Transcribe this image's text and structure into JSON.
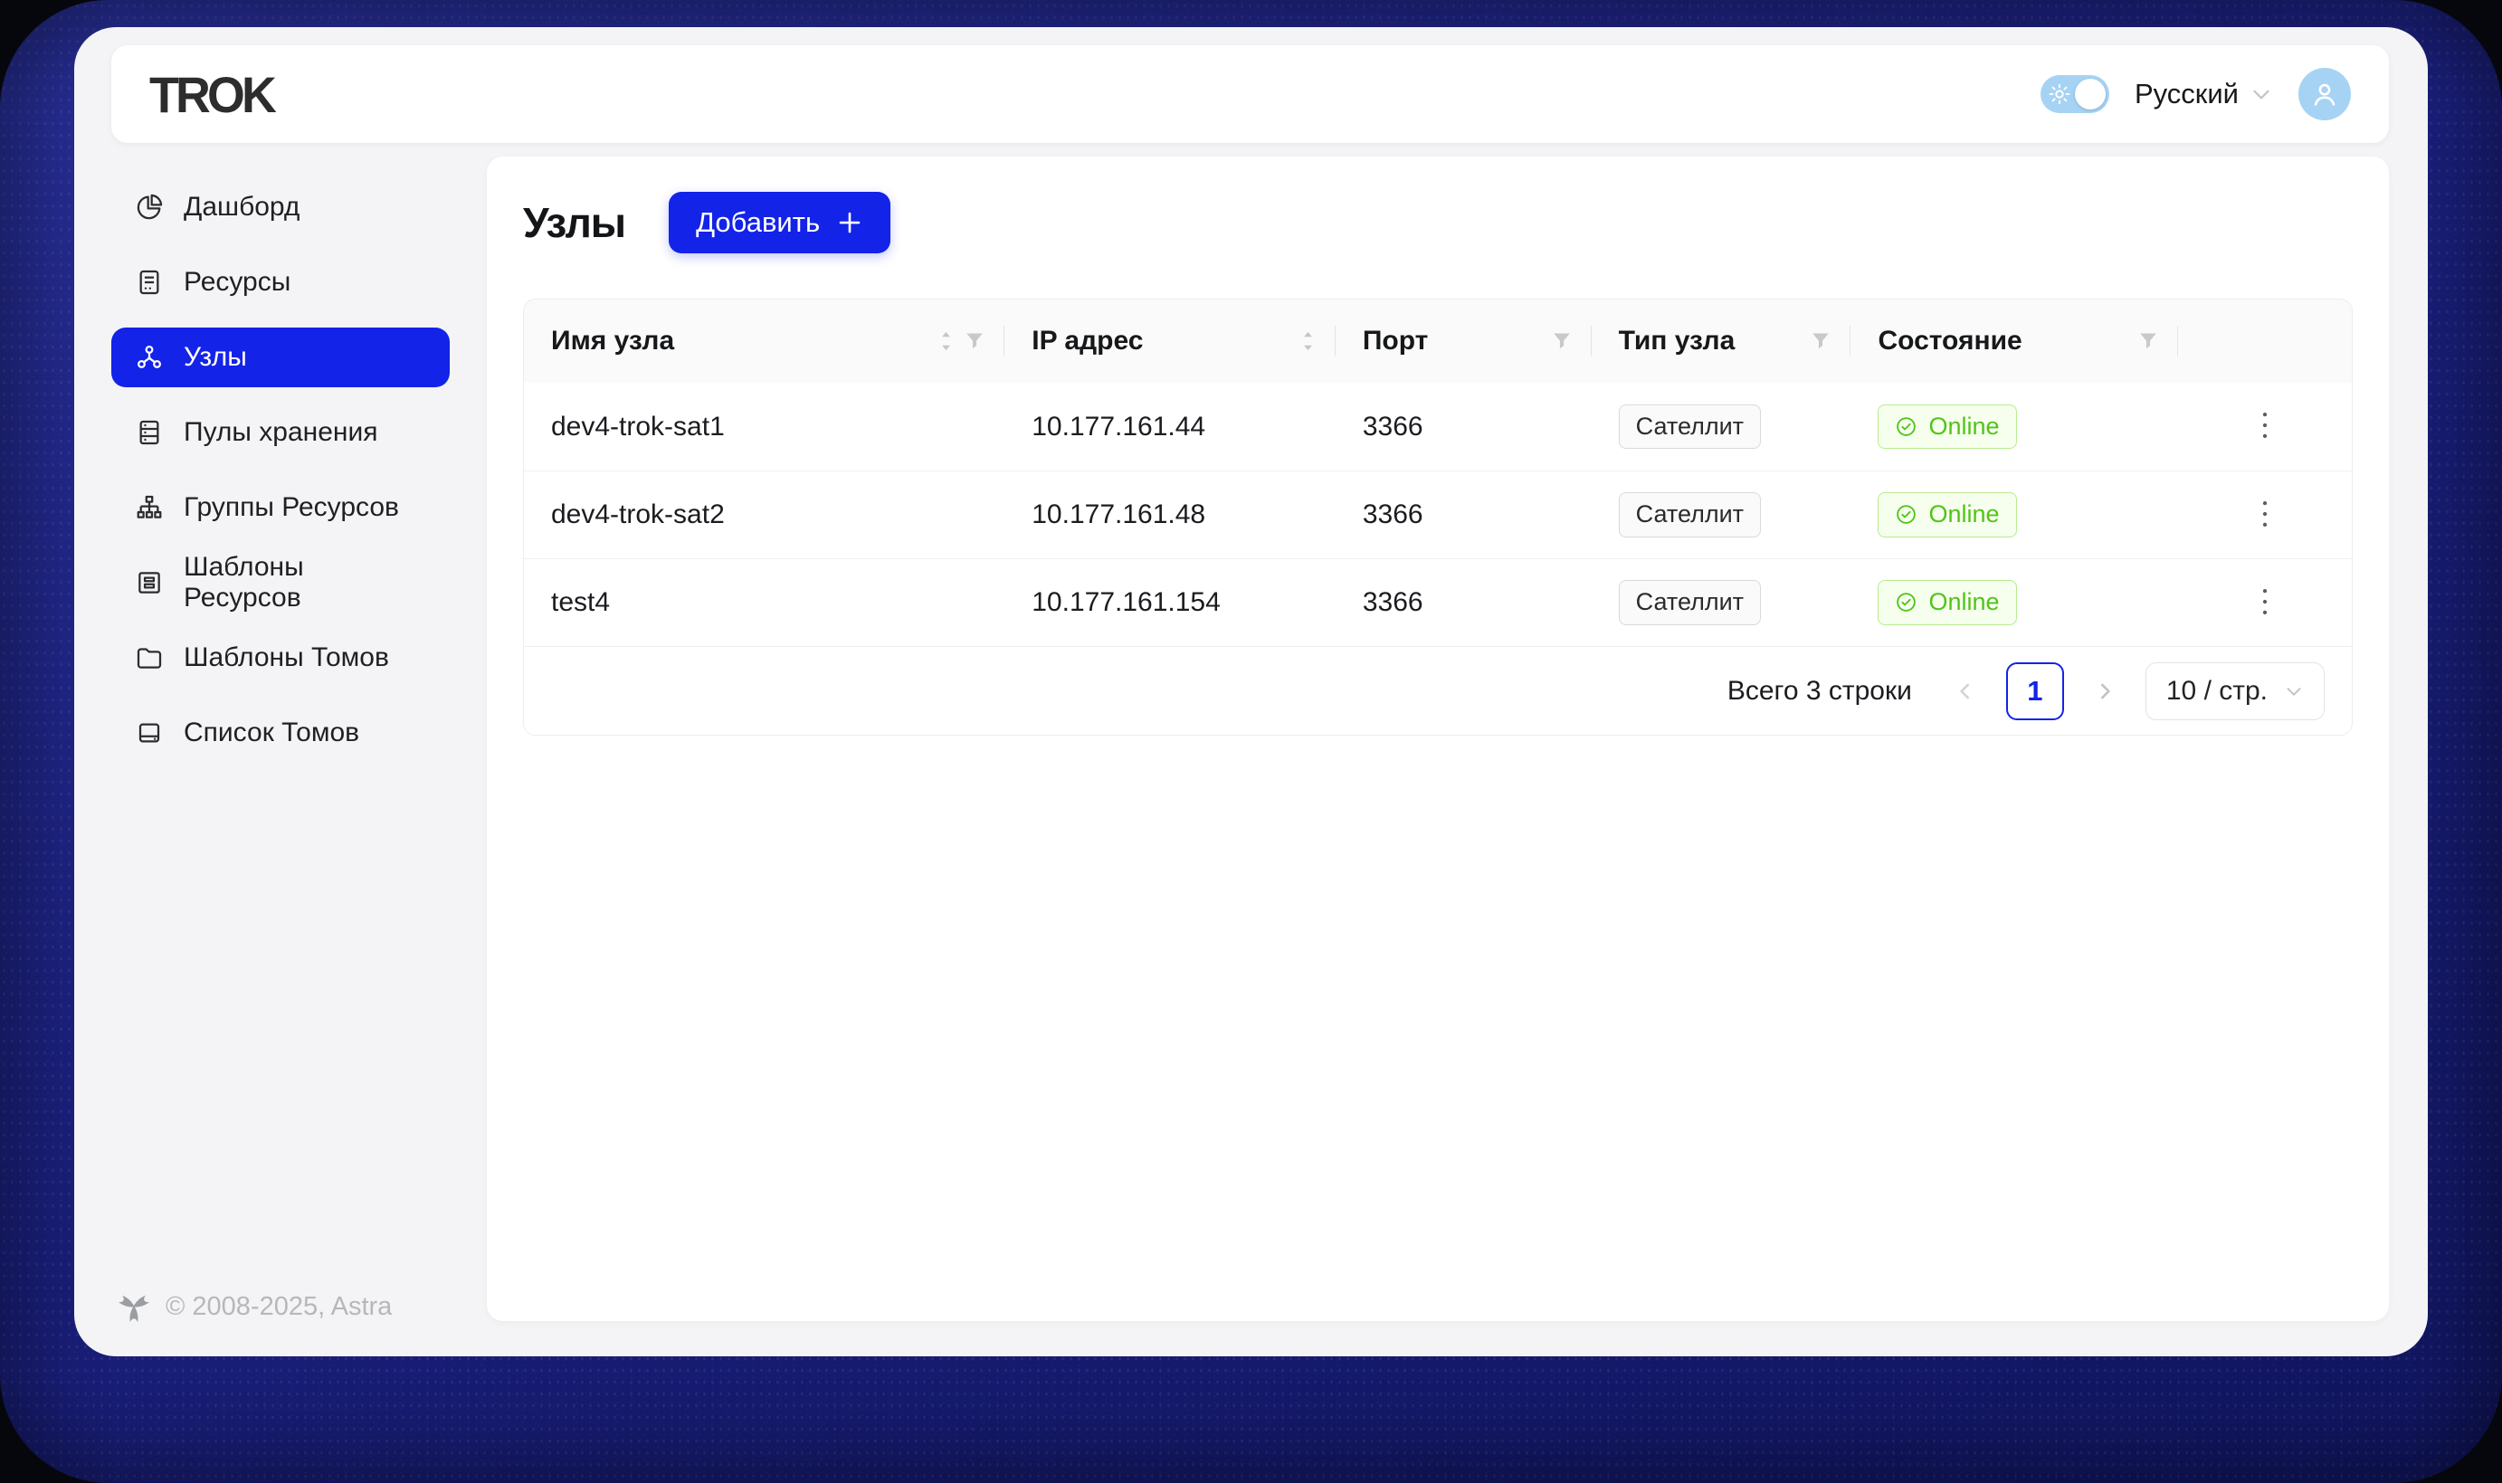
{
  "header": {
    "logo": "TROK",
    "language": {
      "label": "Русский"
    },
    "theme_toggle": {
      "state": "on"
    }
  },
  "sidebar": {
    "items": [
      {
        "label": "Дашборд",
        "icon": "pie-chart-icon",
        "active": false
      },
      {
        "label": "Ресурсы",
        "icon": "hdd-icon",
        "active": false
      },
      {
        "label": "Узлы",
        "icon": "nodes-icon",
        "active": true
      },
      {
        "label": "Пулы хранения",
        "icon": "database-icon",
        "active": false
      },
      {
        "label": "Группы Ресурсов",
        "icon": "cluster-icon",
        "active": false
      },
      {
        "label": "Шаблоны Ресурсов",
        "icon": "template-icon",
        "active": false
      },
      {
        "label": "Шаблоны Томов",
        "icon": "folder-icon",
        "active": false
      },
      {
        "label": "Список Томов",
        "icon": "drive-icon",
        "active": false
      }
    ],
    "copyright": "© 2008-2025, Astra"
  },
  "main": {
    "title": "Узлы",
    "add_button_label": "Добавить",
    "table": {
      "columns": [
        {
          "label": "Имя узла",
          "sortable": true,
          "filterable": true
        },
        {
          "label": "IP адрес",
          "sortable": true,
          "filterable": false
        },
        {
          "label": "Порт",
          "sortable": false,
          "filterable": true
        },
        {
          "label": "Тип узла",
          "sortable": false,
          "filterable": true
        },
        {
          "label": "Состояние",
          "sortable": false,
          "filterable": true
        }
      ],
      "rows": [
        {
          "name": "dev4-trok-sat1",
          "ip": "10.177.161.44",
          "port": "3366",
          "type": "Сателлит",
          "status": "Online"
        },
        {
          "name": "dev4-trok-sat2",
          "ip": "10.177.161.48",
          "port": "3366",
          "type": "Сателлит",
          "status": "Online"
        },
        {
          "name": "test4",
          "ip": "10.177.161.154",
          "port": "3366",
          "type": "Сателлит",
          "status": "Online"
        }
      ],
      "pagination": {
        "total": "Всего 3 строки",
        "current_page": "1",
        "page_size": "10 / стр."
      }
    }
  },
  "colors": {
    "primary": "#1323e8",
    "frame": "#1a1f7b",
    "frame_light": "#272e95",
    "light_blue": "#a6d3f3",
    "success_text": "#52c41a",
    "success_bg": "#f6ffed",
    "success_border": "#b7eb8f"
  }
}
